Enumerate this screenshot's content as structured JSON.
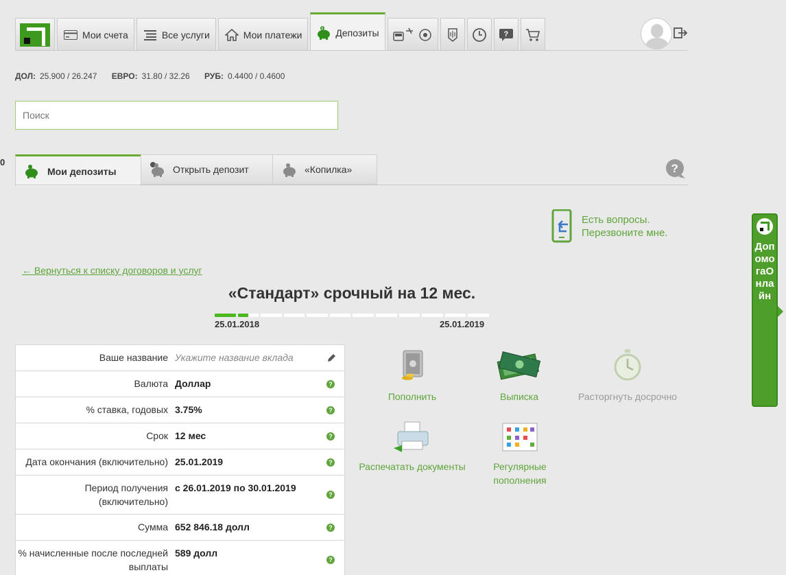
{
  "nav": {
    "tabs": [
      {
        "label": "Мои счета",
        "icon": "card-icon"
      },
      {
        "label": "Все услуги",
        "icon": "list-icon"
      },
      {
        "label": "Мои платежи",
        "icon": "home-icon"
      },
      {
        "label": "Депозиты",
        "icon": "piggy-bank-icon"
      }
    ],
    "icon_tabs": [
      "transport-icon",
      "coat-of-arms-icon",
      "timer-icon",
      "question-icon",
      "cart-icon"
    ]
  },
  "rates": {
    "usd_label": "ДОЛ:",
    "usd_value": "25.900 / 26.247",
    "eur_label": "ЕВРО:",
    "eur_value": "31.80 / 32.26",
    "rub_label": "РУБ:",
    "rub_value": "0.4400 / 0.4600"
  },
  "search": {
    "placeholder": "Поиск"
  },
  "left_stub": "0",
  "subtabs": {
    "my_deposits": "Мои депозиты",
    "open_deposit": "Открыть депозит",
    "kopilka": "«Копилка»"
  },
  "callback": {
    "line1": "Есть вопросы.",
    "line2": "Перезвоните мне."
  },
  "back_link": "← Вернуться к списку договоров и услуг",
  "deposit": {
    "title": "«Стандарт» срочный на 12 мес.",
    "start_date": "25.01.2018",
    "end_date": "25.01.2019",
    "progress_fraction": 0.125
  },
  "details": [
    {
      "label": "Ваше название",
      "value": "Укажите название вклада",
      "placeholder": true
    },
    {
      "label": "Валюта",
      "value": "Доллар"
    },
    {
      "label": "% ставка, годовых",
      "value": "3.75%"
    },
    {
      "label": "Срок",
      "value": "12 мес"
    },
    {
      "label": "Дата окончания (включительно)",
      "value": "25.01.2019"
    },
    {
      "label": "Период получения (включительно)",
      "value": "с 26.01.2019 по 30.01.2019"
    },
    {
      "label": "Сумма",
      "value": "652 846.18  долл"
    },
    {
      "label": "% начисленные после последней выплаты",
      "value": "589  долл"
    }
  ],
  "actions": {
    "replenish": "Пополнить",
    "statement": "Выписка",
    "terminate": "Расторгнуть досрочно",
    "print": "Распечатать документы",
    "regular_1": "Регулярные",
    "regular_2": "пополнения"
  },
  "side_help": "ДопомогаОнлайн",
  "colors": {
    "accent": "#5fa53b",
    "brand": "#3d9a1e",
    "progress": "#4bb821"
  }
}
